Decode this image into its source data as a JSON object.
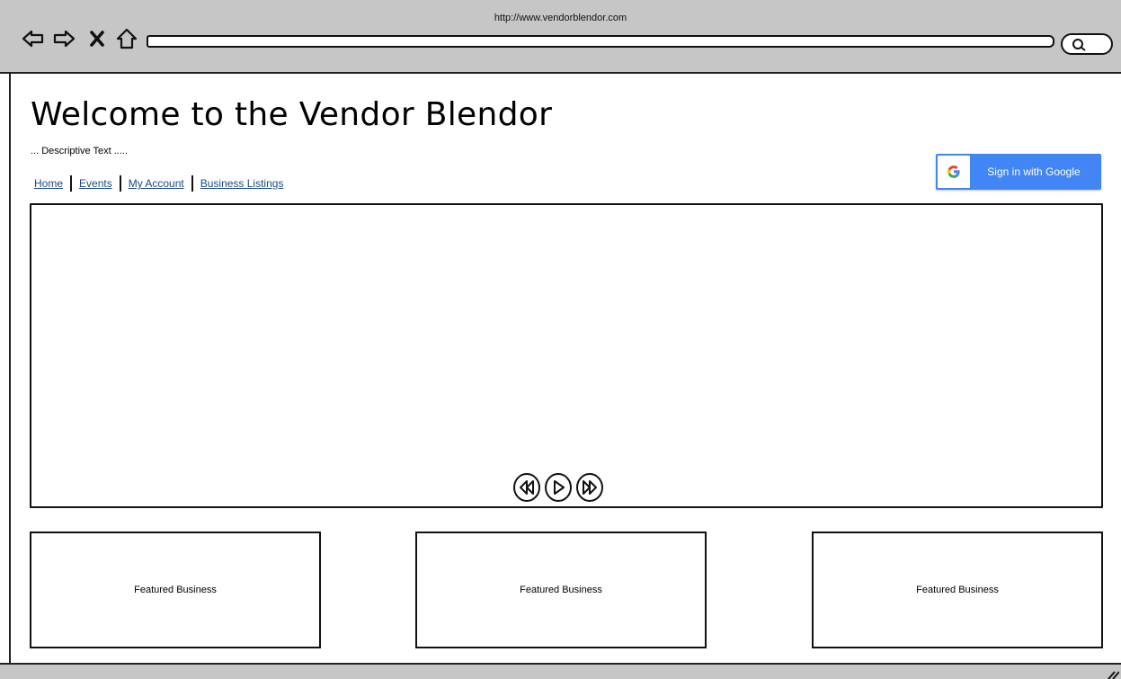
{
  "browser": {
    "url": "http://www.vendorblendor.com",
    "nav_icons": [
      "back-arrow-icon",
      "forward-arrow-icon",
      "stop-icon",
      "home-icon"
    ],
    "search_icon": "magnifier-icon"
  },
  "header": {
    "title": "Welcome to the Vendor Blendor",
    "description": "... Descriptive Text ....."
  },
  "nav": {
    "links": [
      {
        "label": "Home"
      },
      {
        "label": "Events"
      },
      {
        "label": "My Account"
      },
      {
        "label": "Business Listings"
      }
    ]
  },
  "auth": {
    "google_label": "Sign in with Google",
    "google_letter": "G",
    "button_color": "#4285f4"
  },
  "video": {
    "controls": [
      "rewind-icon",
      "play-icon",
      "fast-forward-icon"
    ]
  },
  "featured": [
    {
      "label": "Featured Business"
    },
    {
      "label": "Featured Business"
    },
    {
      "label": "Featured Business"
    }
  ]
}
